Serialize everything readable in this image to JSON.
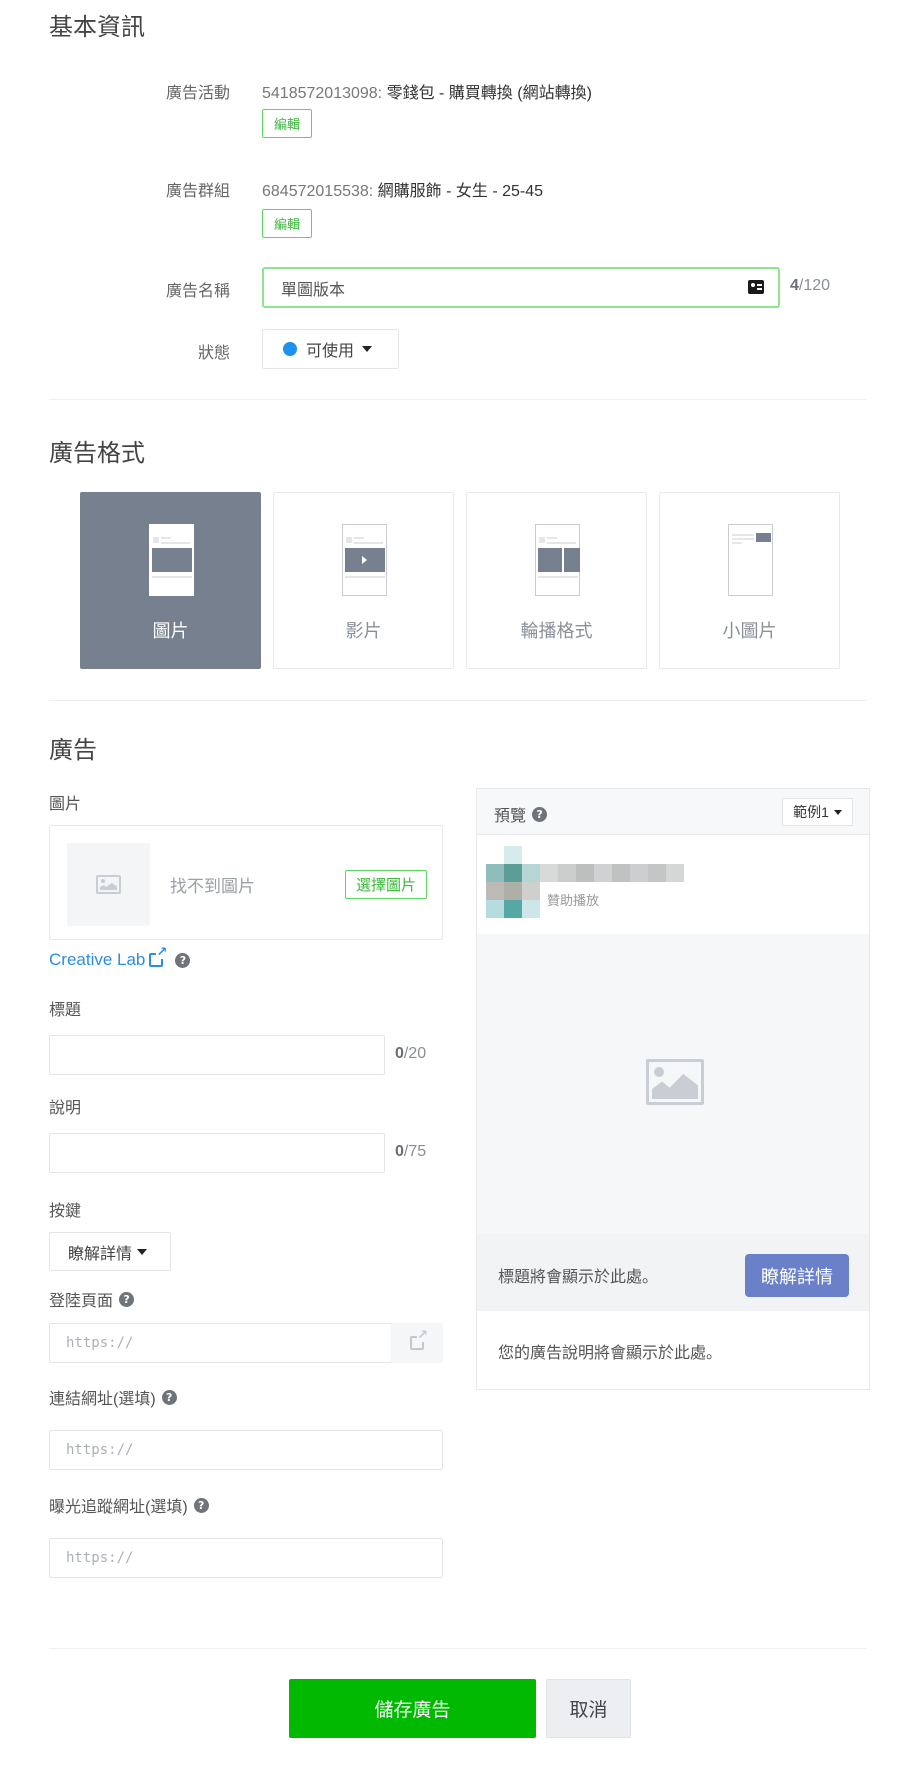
{
  "basic_info": {
    "title": "基本資訊",
    "campaign": {
      "label": "廣告活動",
      "id_name": "5418572013098: ",
      "name": "零錢包 - 購買轉換 (網站轉換)",
      "edit_label": "編輯"
    },
    "ad_group": {
      "label": "廣告群組",
      "id_name": "684572015538: ",
      "name": "網購服飾 - 女生 - ",
      "age": "25-45",
      "edit_label": "編輯"
    },
    "ad_name": {
      "label": "廣告名稱",
      "value": "單圖版本",
      "count": "4",
      "max": "/120",
      "icon": "contact-card-icon"
    },
    "status": {
      "label": "狀態",
      "value": "可使用",
      "color": "#1e90f0"
    }
  },
  "ad_format": {
    "title": "廣告格式",
    "options": [
      {
        "label": "圖片",
        "selected": true,
        "icon": "single-image-format-icon"
      },
      {
        "label": "影片",
        "selected": false,
        "icon": "video-format-icon"
      },
      {
        "label": "輪播格式",
        "selected": false,
        "icon": "carousel-format-icon"
      },
      {
        "label": "小圖片",
        "selected": false,
        "icon": "small-image-format-icon"
      }
    ]
  },
  "ad": {
    "title": "廣告",
    "image": {
      "label": "圖片",
      "empty_text": "找不到圖片",
      "choose_label": "選擇圖片"
    },
    "creative_lab": "Creative Lab",
    "headline": {
      "label": "標題",
      "value": "",
      "count": "0",
      "max": "/20"
    },
    "description": {
      "label": "說明",
      "value": "",
      "count": "0",
      "max": "/75"
    },
    "cta": {
      "label": "按鍵",
      "value": "瞭解詳情"
    },
    "landing_page": {
      "label": "登陸頁面",
      "placeholder": "https://"
    },
    "link_url": {
      "label": "連結網址(選填)",
      "placeholder": "https://"
    },
    "impression_url": {
      "label": "曝光追蹤網址(選填)",
      "placeholder": "https://"
    }
  },
  "preview": {
    "title": "預覽",
    "sample_select": "範例1",
    "sponsored": "贊助播放",
    "headline_placeholder": "標題將會顯示於此處。",
    "cta_label": "瞭解詳情",
    "cta_color": "#6a80c8",
    "description_placeholder": "您的廣告說明將會顯示於此處。"
  },
  "footer": {
    "save_label": "儲存廣告",
    "cancel_label": "取消",
    "save_color": "#00b900"
  }
}
